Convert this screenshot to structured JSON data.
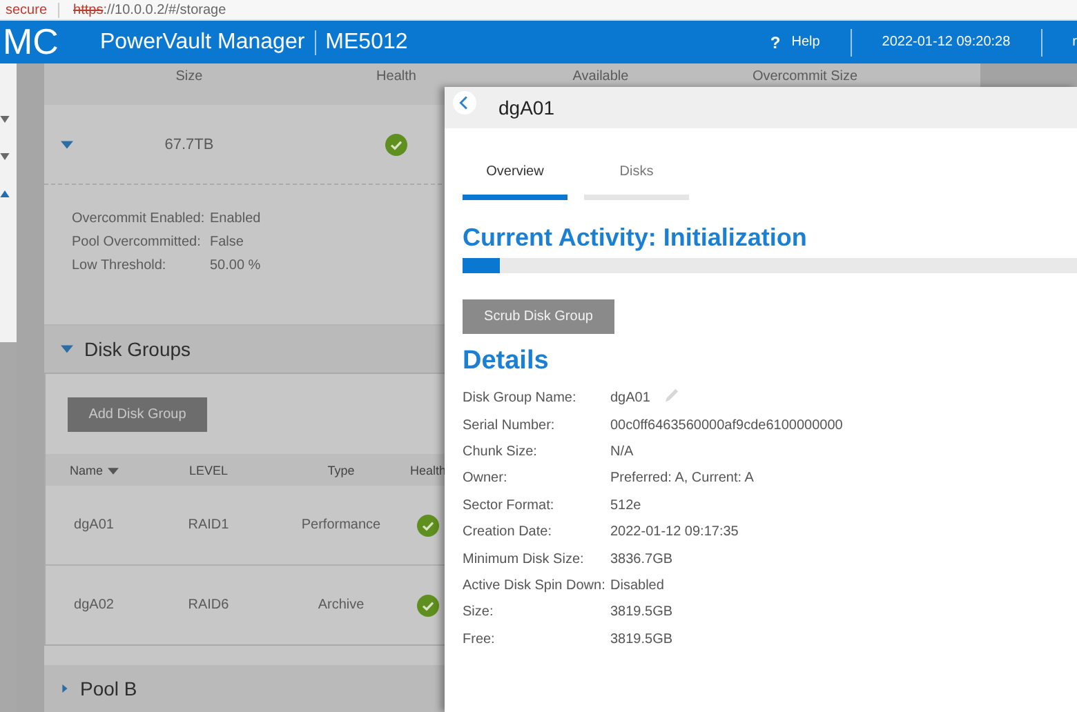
{
  "browser": {
    "security": "secure",
    "url_scheme": "https",
    "url_rest": "://10.0.0.2/#/storage"
  },
  "header": {
    "logo": "MC",
    "product": "PowerVault Manager",
    "model": "ME5012",
    "help_icon": "?",
    "help": "Help",
    "datetime": "2022-01-12 09:20:28",
    "user": "r"
  },
  "sidebar": {
    "items": [
      {
        "expanded": false
      },
      {
        "expanded": false
      },
      {
        "expanded": true
      }
    ]
  },
  "pool": {
    "columns": [
      "Size",
      "Health",
      "Available",
      "Overcommit Size"
    ],
    "expanded": true,
    "size": "67.7TB",
    "color": "#5f8f1e",
    "properties": [
      {
        "label": "Overcommit Enabled:",
        "value": "Enabled"
      },
      {
        "label": "Pool Overcommitted:",
        "value": "False"
      },
      {
        "label": "Low Threshold:",
        "value": "50.00 %"
      }
    ]
  },
  "disk_groups": {
    "title": "Disk Groups",
    "expanded": true,
    "add_button": "Add Disk Group",
    "columns": [
      {
        "label": "Name",
        "sorted": true
      },
      {
        "label": "LEVEL",
        "sorted": false
      },
      {
        "label": "Type",
        "sorted": false
      },
      {
        "label": "Health",
        "sorted": false
      }
    ],
    "rows": [
      {
        "name": "dgA01",
        "raid": "RAID1",
        "type": "Performance",
        "color": "#5f8f1e"
      },
      {
        "name": "dgA02",
        "raid": "RAID6",
        "type": "Archive",
        "color": "#5f8f1e"
      }
    ]
  },
  "next_pool": {
    "title": "Pool B",
    "expanded": false
  },
  "panel": {
    "title": "dgA01",
    "tabs": [
      {
        "label": "Overview",
        "selected": true
      },
      {
        "label": "Disks",
        "selected": false
      }
    ],
    "activity": "Current Activity: Initialization",
    "progress": {
      "level": 0.06
    },
    "scrub_button": "Scrub Disk Group",
    "details_title": "Details",
    "details": [
      {
        "label": "Disk Group Name:",
        "value": "dgA01",
        "editable": true
      },
      {
        "label": "Serial Number:",
        "value": "00c0ff6463560000af9cde6100000000",
        "editable": false
      },
      {
        "label": "Chunk Size:",
        "value": "N/A",
        "editable": false
      },
      {
        "label": "Owner:",
        "value": "Preferred: A, Current: A",
        "editable": false
      },
      {
        "label": "Sector Format:",
        "value": "512e",
        "editable": false
      },
      {
        "label": "Creation Date:",
        "value": "2022-01-12 09:17:35",
        "editable": false
      },
      {
        "label": "Minimum Disk Size:",
        "value": "3836.7GB",
        "editable": false
      },
      {
        "label": "Active Disk Spin Down:",
        "value": "Disabled",
        "editable": false
      },
      {
        "label": "Size:",
        "value": "3819.5GB",
        "editable": false
      },
      {
        "label": "Free:",
        "value": "3819.5GB",
        "editable": false
      }
    ]
  }
}
